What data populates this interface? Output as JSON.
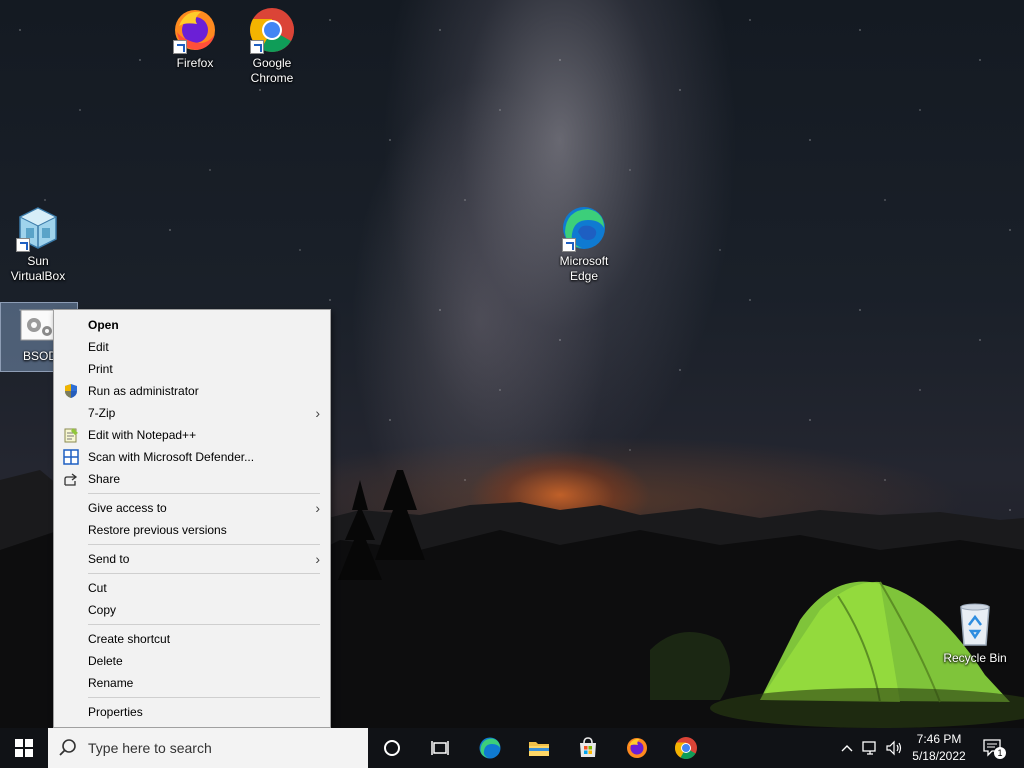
{
  "desktop": {
    "icons": [
      {
        "label": "Firefox",
        "icon": "firefox-icon"
      },
      {
        "label": "Google Chrome",
        "icon": "chrome-icon"
      },
      {
        "label": "Sun VirtualBox",
        "icon": "virtualbox-icon"
      },
      {
        "label": "BSOD",
        "icon": "settings-file-icon"
      },
      {
        "label": "Microsoft Edge",
        "icon": "edge-icon"
      },
      {
        "label": "Recycle Bin",
        "icon": "recycle-bin-icon"
      }
    ]
  },
  "context_menu": {
    "groups": [
      [
        {
          "label": "Open",
          "bold": true
        },
        {
          "label": "Edit"
        },
        {
          "label": "Print"
        },
        {
          "label": "Run as administrator",
          "icon": "uac-shield-icon"
        },
        {
          "label": "7-Zip",
          "submenu": true
        },
        {
          "label": "Edit with Notepad++",
          "icon": "notepadplusplus-icon"
        },
        {
          "label": "Scan with Microsoft Defender...",
          "icon": "defender-icon"
        },
        {
          "label": "Share",
          "icon": "share-icon"
        }
      ],
      [
        {
          "label": "Give access to",
          "submenu": true
        },
        {
          "label": "Restore previous versions"
        }
      ],
      [
        {
          "label": "Send to",
          "submenu": true
        }
      ],
      [
        {
          "label": "Cut"
        },
        {
          "label": "Copy"
        }
      ],
      [
        {
          "label": "Create shortcut"
        },
        {
          "label": "Delete"
        },
        {
          "label": "Rename"
        }
      ],
      [
        {
          "label": "Properties"
        }
      ]
    ],
    "submenu_arrow": "›"
  },
  "taskbar": {
    "search_placeholder": "Type here to search",
    "pinned": [
      "cortana-icon",
      "task-view-icon",
      "edge-icon",
      "file-explorer-icon",
      "microsoft-store-icon",
      "firefox-icon",
      "chrome-icon"
    ],
    "time": "7:46 PM",
    "date": "5/18/2022",
    "notification_count": "1"
  },
  "colors": {
    "menu_bg": "#f2f2f2",
    "taskbar_bg": "#101216",
    "search_bg": "#f3f3f3",
    "edge_blue": "#0f7ad1",
    "edge_green": "#3ccf7a"
  }
}
